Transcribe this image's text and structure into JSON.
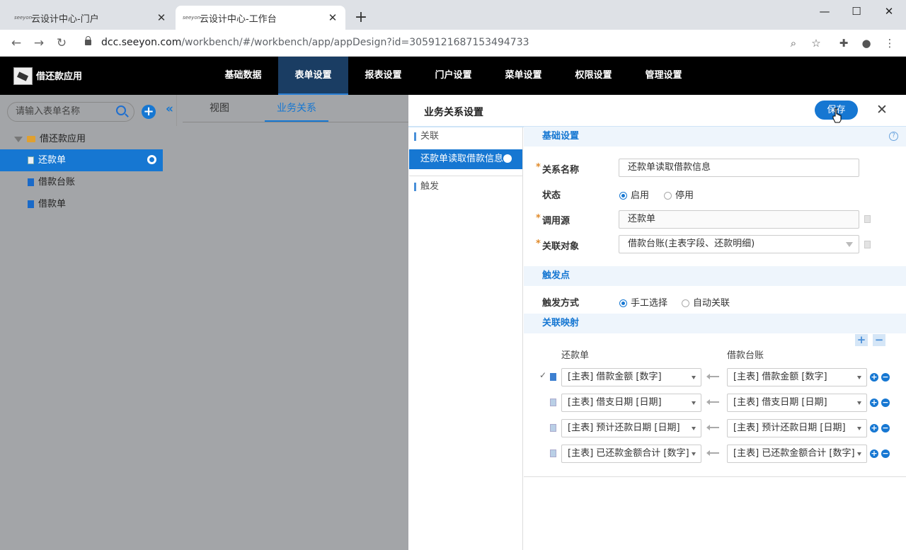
{
  "browser": {
    "tabs": [
      {
        "title": "云设计中心-门户",
        "favicon_text": "seeyon"
      },
      {
        "title": "云设计中心-工作台",
        "favicon_text": "seeyon"
      }
    ],
    "new_tab": "+",
    "url_host": "dcc.seeyon.com",
    "url_rest": "/workbench/#/workbench/app/appDesign?id=3059121687153494733",
    "window_controls": {
      "minimize": "—",
      "maximize": "☐",
      "close": "✕"
    }
  },
  "app": {
    "name": "借还款应用",
    "menu": [
      {
        "label": "基础数据",
        "active": false
      },
      {
        "label": "表单设置",
        "active": true
      },
      {
        "label": "报表设置",
        "active": false
      },
      {
        "label": "门户设置",
        "active": false
      },
      {
        "label": "菜单设置",
        "active": false
      },
      {
        "label": "权限设置",
        "active": false
      },
      {
        "label": "管理设置",
        "active": false
      }
    ]
  },
  "sidebar": {
    "search_placeholder": "请输入表单名称",
    "add": "+",
    "tree": [
      {
        "label": "借还款应用",
        "type": "folder"
      },
      {
        "label": "还款单",
        "type": "form",
        "selected": true
      },
      {
        "label": "借款台账",
        "type": "form"
      },
      {
        "label": "借款单",
        "type": "form"
      }
    ]
  },
  "middle": {
    "collapse": "«",
    "tabs": [
      {
        "label": "视图",
        "active": false
      },
      {
        "label": "业务关系",
        "active": true
      }
    ]
  },
  "panel": {
    "title": "业务关系设置",
    "save": "保存",
    "close": "✕",
    "left": {
      "section_relation": "关联",
      "relation_item": "还款单读取借款信息",
      "section_trigger": "触发"
    },
    "basic": {
      "header": "基础设置",
      "help": "?",
      "name_label": "关系名称",
      "name_value": "还款单读取借款信息",
      "status_label": "状态",
      "status_on": "启用",
      "status_off": "停用",
      "source_label": "调用源",
      "source_value": "还款单",
      "target_label": "关联对象",
      "target_value": "借款台账(主表字段、还款明细)"
    },
    "trigger": {
      "header": "触发点",
      "mode_label": "触发方式",
      "mode_manual": "手工选择",
      "mode_auto": "自动关联"
    },
    "mapping": {
      "header": "关联映射",
      "add": "+",
      "remove": "−",
      "left_header": "还款单",
      "right_header": "借款台账",
      "rows": [
        {
          "left": "[主表] 借款金额 [数字]",
          "right": "[主表] 借款金额 [数字]",
          "checked": true
        },
        {
          "left": "[主表] 借支日期 [日期]",
          "right": "[主表] 借支日期 [日期]",
          "checked": false
        },
        {
          "left": "[主表] 预计还款日期 [日期]",
          "right": "[主表] 预计还款日期 [日期]",
          "checked": false
        },
        {
          "left": "[主表] 已还款金额合计 [数字]",
          "right": "[主表] 已还款金额合计 [数字]",
          "checked": false
        }
      ]
    }
  },
  "colors": {
    "accent": "#1677d2",
    "header_bg": "#000000",
    "overlay": "#a3a5a8"
  }
}
